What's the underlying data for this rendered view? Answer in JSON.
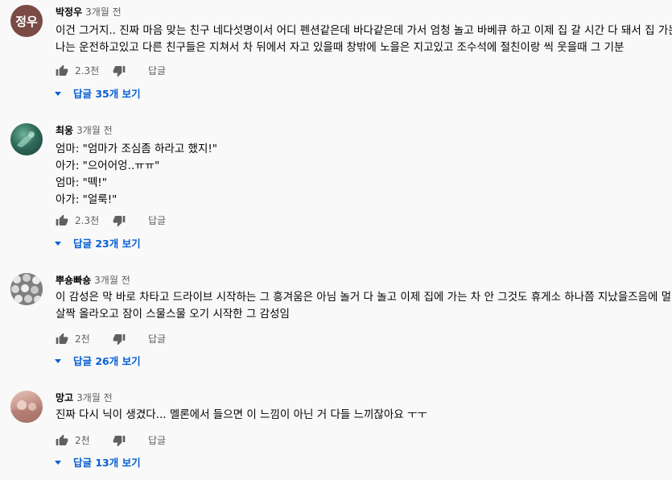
{
  "comments": [
    {
      "author": "박정우",
      "time": "3개월 전",
      "avatar_text": "정우",
      "avatar_color": "#7a4a44",
      "lines": [
        "이건 그거지.. 진짜 마음 맞는 친구 네다섯명이서 어디 펜션같은데 바다같은데 가서 엄청 놀고 바베큐 하고 이제 집 갈 시간 다 돼서 집 가는데",
        "나는 운전하고있고 다른 친구들은 지쳐서 차 뒤에서 자고 있을때 창밖에 노을은 지고있고 조수석에 절친이랑 씩 웃을때 그 기분"
      ],
      "likes": "2.3천",
      "reply_label": "답글",
      "replies_label": "답글 35개 보기"
    },
    {
      "author": "최웅",
      "time": "3개월 전",
      "avatar_color": "#2f6b5a",
      "lines": [
        "엄마: \"엄마가 조심좀 하라고 했지!\"",
        "아가: \"으어어엉..ㅠㅠ\"",
        "엄마: \"떽!\"",
        "아가: \"얼룩!\""
      ],
      "likes": "2.3천",
      "reply_label": "답글",
      "replies_label": "답글 23개 보기"
    },
    {
      "author": "뿌숑빠숑",
      "time": "3개월 전",
      "avatar_color": "#9a9a9a",
      "lines": [
        "이 감성은 막 바로 차타고 드라이브 시작하는 그 흥겨움은 아님 놀거 다 놀고 이제 집에 가는 차 안 그것도 휴게소 하나쯤 지났을즈음에 멀미가",
        "살짝 올라오고 잠이 스물스물 오기 시작한 그 감성임"
      ],
      "likes": "2천",
      "reply_label": "답글",
      "replies_label": "답글 26개 보기"
    },
    {
      "author": "망고",
      "time": "3개월 전",
      "avatar_color": "#c9a59a",
      "lines": [
        "진짜 다시 닉이 생겼다... 멜론에서 들으면 이 느낌이 아닌 거 다들 느끼잖아요 ㅜㅜ"
      ],
      "likes": "2천",
      "reply_label": "답글",
      "replies_label": "답글 13개 보기"
    }
  ],
  "icons": {
    "like": "thumbs-up-icon",
    "dislike": "thumbs-down-icon",
    "expand": "caret-down-icon"
  },
  "colors": {
    "link": "#065fd4",
    "secondary_text": "#606060",
    "background": "#f9f9f9"
  }
}
